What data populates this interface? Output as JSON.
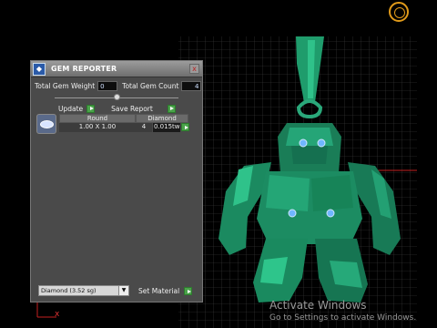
{
  "panel": {
    "title": "GEM REPORTER",
    "app_icon": "gem-reporter-app-icon",
    "close_glyph": "x",
    "weight_label": "Total Gem Weight",
    "weight_value": "0",
    "count_label": "Total Gem Count",
    "count_value": "4",
    "slider_level": 0.5,
    "update_label": "Update",
    "save_report_label": "Save Report",
    "table": {
      "gem_icon": "round-diamond-gem-icon",
      "col_shape_header": "Round",
      "col_shape_value": "1.00 X 1.00",
      "col_material_header": "Diamond",
      "col_count_value": "4",
      "col_weight_value": "0.015tw"
    },
    "material_select": "Diamond   (3.52 sg)",
    "set_material_label": "Set Material"
  },
  "viewport": {
    "axis_label": "x",
    "orientation_icon": "view-orientation-ring-icon",
    "model_color": "#1f9c6c"
  },
  "watermark": {
    "line1": "Activate Windows",
    "line2": "Go to Settings to activate Windows."
  }
}
